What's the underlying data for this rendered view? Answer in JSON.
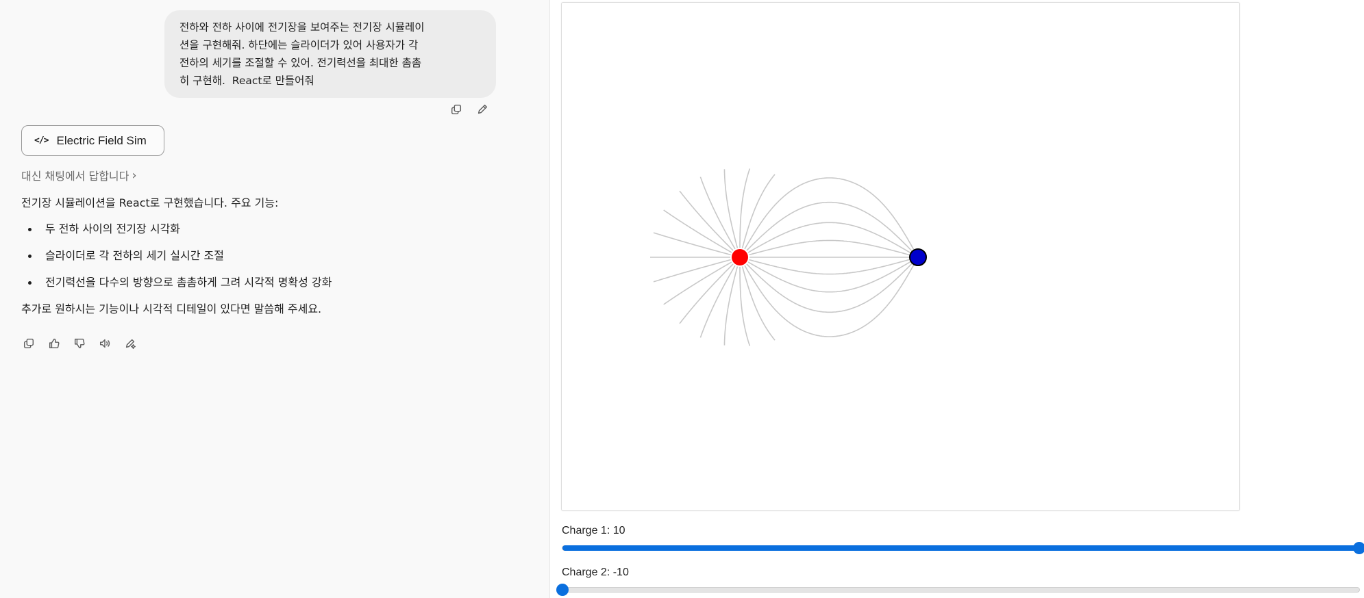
{
  "chat": {
    "user_message": "전하와 전하 사이에 전기장을 보여주는 전기장 시뮬레이\n션을 구현해줘. 하단에는 슬라이더가 있어 사용자가 각\n전하의 세기를 조절할 수 있어. 전기력선을 최대한 촘촘\n히 구현해.  React로 만들어줘",
    "artifact_button_label": "Electric Field Sim",
    "artifact_icon": "code-icon",
    "reply_link": "대신 채팅에서 답합니다",
    "assistant_intro": "전기장 시뮬레이션을 React로 구현했습니다. 주요 기능:",
    "features": [
      "두 전하 사이의 전기장 시각화",
      "슬라이더로 각 전하의 세기 실시간 조절",
      "전기력선을 다수의 방향으로 촘촘하게 그려 시각적 명확성 강화"
    ],
    "assistant_outro": "추가로 원하시는 기능이나 시각적 디테일이 있다면 말씀해 주세요.",
    "user_actions": [
      "copy-icon",
      "edit-icon"
    ],
    "assistant_actions": [
      "copy-icon",
      "thumbs-up-icon",
      "thumbs-down-icon",
      "speaker-icon",
      "edit-sparkle-icon"
    ]
  },
  "simulation": {
    "positive_charge_color": "#ff0000",
    "negative_charge_color": "#0000cc",
    "field_line_color": "#c8c8c8",
    "field_lines_per_charge": 24
  },
  "sliders": [
    {
      "label": "Charge 1: 10",
      "value": 10,
      "min": -10,
      "max": 10
    },
    {
      "label": "Charge 2: -10",
      "value": -10,
      "min": -10,
      "max": 10
    }
  ],
  "colors": {
    "accent": "#0a6fde",
    "chat_bg": "#f9f9f9",
    "bubble_bg": "#ececec"
  }
}
